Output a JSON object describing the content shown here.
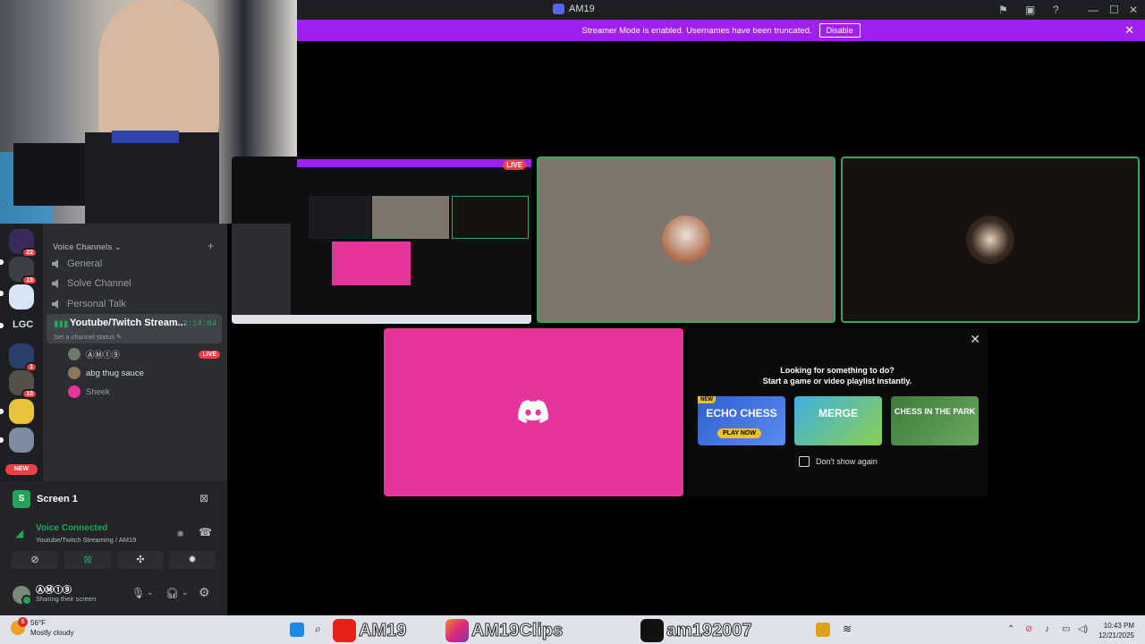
{
  "window": {
    "title": "AM19",
    "banner_text": "Streamer Mode is enabled. Usernames have been truncated.",
    "banner_button": "Disable"
  },
  "servers": [
    {
      "badge": "22"
    },
    {
      "badge": "15"
    },
    {
      "badge": ""
    },
    {
      "label": "LGC"
    },
    {
      "badge": "1"
    },
    {
      "badge": "10"
    },
    {
      "badge": ""
    },
    {
      "badge": ""
    }
  ],
  "new_badge": "NEW",
  "channels": {
    "category": "Voice Channels",
    "list": [
      "General",
      "Solve Channel",
      "Personal Talk"
    ],
    "active": {
      "name": "Youtube/Twitch Stream...",
      "timer": "3:14:04",
      "status": "Set a channel status"
    },
    "members": [
      {
        "name": "ⒶⓂ①⑨",
        "live": "LIVE"
      },
      {
        "name": "abg thug sauce"
      },
      {
        "name": "Sheek"
      }
    ]
  },
  "user_panel": {
    "screen_label": "Screen 1",
    "voice_status": "Voice Connected",
    "voice_channel": "Youtube/Twitch Streaming / AM19",
    "username": "ⒶⓂ①⑨",
    "user_status": "Sharing their screen"
  },
  "stage": {
    "live_label": "LIVE",
    "activity": {
      "line1": "Looking for something to do?",
      "line2": "Start a game or video playlist instantly.",
      "games": [
        {
          "name": "ECHO CHESS",
          "cta": "PLAY NOW",
          "tag": "NEW",
          "color": "#3b6fd8"
        },
        {
          "name": "MERGE",
          "color": "#5ec04a"
        },
        {
          "name": "CHESS IN THE PARK",
          "color": "#4f8c48"
        }
      ],
      "dont_show": "Don't show again"
    }
  },
  "taskbar": {
    "temp": "56°F",
    "condition": "Mostly cloudy",
    "weather_badge": "5",
    "overlays": [
      "AM19",
      "AM19Clips",
      "am192007"
    ],
    "time": "10:43 PM",
    "date": "12/21/2025"
  },
  "colors": {
    "accent_green": "#23a559",
    "streamer_banner": "#a020f0",
    "live_red": "#f23f43",
    "discord_pink": "#e5359c"
  }
}
